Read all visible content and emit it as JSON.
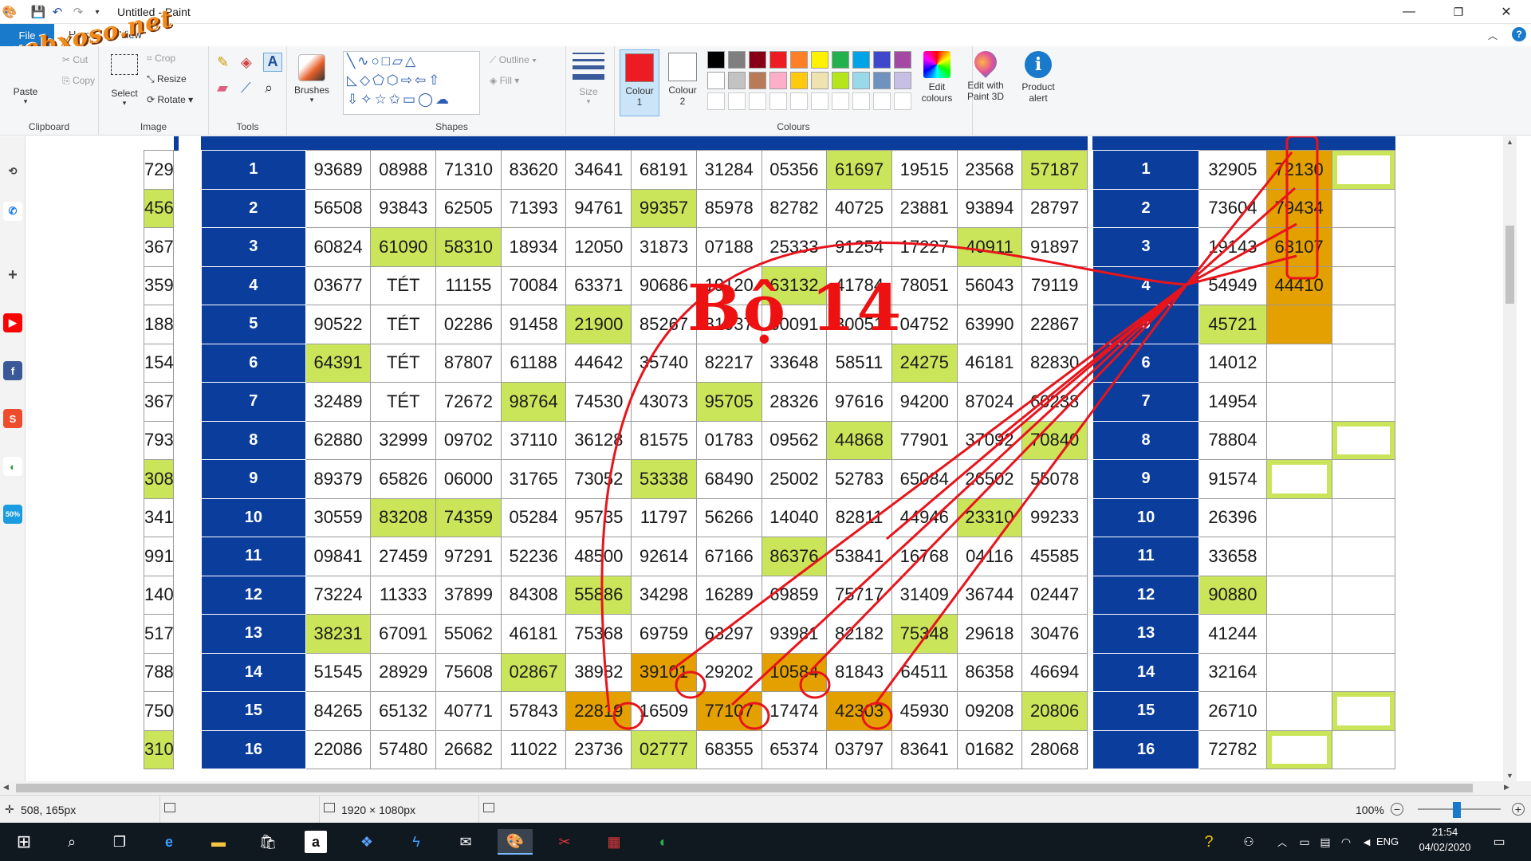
{
  "window": {
    "title": "Untitled - Paint",
    "min": "—",
    "max": "❐",
    "close": "✕"
  },
  "logo_text": "webxoso.net",
  "tabs": {
    "file": "File",
    "home": "Home",
    "view": "View"
  },
  "ribbon": {
    "paste": "Paste",
    "cut": "Cut",
    "copy": "Copy",
    "clipboard": "Clipboard",
    "select": "Select",
    "crop": "Crop",
    "resize": "Resize",
    "rotate": "Rotate",
    "image": "Image",
    "tools": "Tools",
    "brushes": "Brushes",
    "shapes": "Shapes",
    "outline": "Outline",
    "fill": "Fill",
    "size": "Size",
    "colour1": "Colour\n1",
    "colour2": "Colour\n2",
    "colours": "Colours",
    "edit_colours": "Edit\ncolours",
    "edit_paint3d": "Edit with\nPaint 3D",
    "product_alert": "Product\nalert",
    "palette": [
      "#000000",
      "#7f7f7f",
      "#880015",
      "#ed1c24",
      "#ff7f27",
      "#fff200",
      "#22b14c",
      "#00a2e8",
      "#3f48cc",
      "#a349a4",
      "#ffffff",
      "#c3c3c3",
      "#b97a57",
      "#ffaec9",
      "#ffc90e",
      "#efe4b0",
      "#b5e61d",
      "#99d9ea",
      "#7092be",
      "#c8bfe7"
    ],
    "colour1_value": "#ed1c24",
    "colour2_value": "#ffffff"
  },
  "status": {
    "cursor": "508, 165px",
    "dimensions": "1920 × 1080px",
    "zoom": "100%"
  },
  "taskbar": {
    "lang": "ENG",
    "time": "21:54",
    "date": "04/02/2020"
  },
  "annotation": "Bộ 14",
  "left_partial": [
    "729",
    "456",
    "367",
    "359",
    "188",
    "154",
    "367",
    "793",
    "308",
    "341",
    "991",
    "140",
    "517",
    "788",
    "750",
    "310"
  ],
  "left_partial_green": [
    1,
    8,
    15
  ],
  "main_table": {
    "rows": [
      {
        "idx": "1",
        "cells": [
          "93689",
          "08988",
          "71310",
          "83620",
          "34641",
          "68191",
          "31284",
          "05356",
          "61697",
          "19515",
          "23568",
          "57187"
        ],
        "hl": {
          "8": "g",
          "11": "g"
        }
      },
      {
        "idx": "2",
        "cells": [
          "56508",
          "93843",
          "62505",
          "71393",
          "94761",
          "99357",
          "85978",
          "82782",
          "40725",
          "23881",
          "93894",
          "28797"
        ],
        "hl": {
          "5": "g"
        }
      },
      {
        "idx": "3",
        "cells": [
          "60824",
          "61090",
          "58310",
          "18934",
          "12050",
          "31873",
          "07188",
          "25333",
          "91254",
          "17227",
          "40911",
          "91897"
        ],
        "hl": {
          "1": "g",
          "2": "g",
          "10": "g"
        }
      },
      {
        "idx": "4",
        "cells": [
          "03677",
          "TÉT",
          "11155",
          "70084",
          "63371",
          "90686",
          "19120",
          "63132",
          "41784",
          "78051",
          "56043",
          "79119"
        ],
        "hl": {
          "1": "tet",
          "7": "g"
        }
      },
      {
        "idx": "5",
        "cells": [
          "90522",
          "TÉT",
          "02286",
          "91458",
          "21900",
          "85267",
          "81937",
          "60091",
          "30051",
          "04752",
          "63990",
          "22867"
        ],
        "hl": {
          "1": "tet",
          "4": "g"
        }
      },
      {
        "idx": "6",
        "cells": [
          "64391",
          "TÉT",
          "87807",
          "61188",
          "44642",
          "35740",
          "82217",
          "33648",
          "58511",
          "24275",
          "46181",
          "82830"
        ],
        "hl": {
          "0": "g",
          "1": "tet",
          "9": "g"
        }
      },
      {
        "idx": "7",
        "cells": [
          "32489",
          "TÉT",
          "72672",
          "98764",
          "74530",
          "43073",
          "95705",
          "28326",
          "97616",
          "94200",
          "87024",
          "60238"
        ],
        "hl": {
          "1": "tet",
          "3": "g",
          "6": "g"
        }
      },
      {
        "idx": "8",
        "cells": [
          "62880",
          "32999",
          "09702",
          "37110",
          "36128",
          "81575",
          "01783",
          "09562",
          "44868",
          "77901",
          "37092",
          "70840"
        ],
        "hl": {
          "8": "g",
          "11": "g"
        }
      },
      {
        "idx": "9",
        "cells": [
          "89379",
          "65826",
          "06000",
          "31765",
          "73052",
          "53338",
          "68490",
          "25002",
          "52783",
          "65084",
          "26502",
          "55078"
        ],
        "hl": {
          "5": "g"
        }
      },
      {
        "idx": "10",
        "cells": [
          "30559",
          "83208",
          "74359",
          "05284",
          "95735",
          "11797",
          "56266",
          "14040",
          "82811",
          "44946",
          "23310",
          "99233"
        ],
        "hl": {
          "1": "g",
          "2": "g",
          "10": "g"
        }
      },
      {
        "idx": "11",
        "cells": [
          "09841",
          "27459",
          "97291",
          "52236",
          "48500",
          "92614",
          "67166",
          "86376",
          "53841",
          "16768",
          "04116",
          "45585"
        ],
        "hl": {
          "7": "g"
        }
      },
      {
        "idx": "12",
        "cells": [
          "73224",
          "11333",
          "37899",
          "84308",
          "55886",
          "34298",
          "16289",
          "69859",
          "75717",
          "31409",
          "36744",
          "02447"
        ],
        "hl": {
          "4": "g"
        }
      },
      {
        "idx": "13",
        "cells": [
          "38231",
          "67091",
          "55062",
          "46181",
          "75368",
          "69759",
          "63297",
          "93981",
          "82182",
          "75348",
          "29618",
          "30476"
        ],
        "hl": {
          "0": "g",
          "9": "g"
        }
      },
      {
        "idx": "14",
        "cells": [
          "51545",
          "28929",
          "75608",
          "02867",
          "38982",
          "39101",
          "29202",
          "10584",
          "81843",
          "64511",
          "86358",
          "46694"
        ],
        "hl": {
          "3": "g",
          "5": "o",
          "7": "o"
        }
      },
      {
        "idx": "15",
        "cells": [
          "84265",
          "65132",
          "40771",
          "57843",
          "22819",
          "16509",
          "77107",
          "17474",
          "42303",
          "45930",
          "09208",
          "20806"
        ],
        "hl": {
          "4": "o",
          "6": "o",
          "8": "o",
          "11": "g"
        }
      },
      {
        "idx": "16",
        "cells": [
          "22086",
          "57480",
          "26682",
          "11022",
          "23736",
          "02777",
          "68355",
          "65374",
          "03797",
          "83641",
          "01682",
          "28068"
        ],
        "hl": {
          "5": "g"
        }
      }
    ]
  },
  "right_table": {
    "rows": [
      {
        "idx": "1",
        "val": "32905",
        "c2": "72130",
        "c2c": "o",
        "c3": "white"
      },
      {
        "idx": "2",
        "val": "73604",
        "c2": "79434",
        "c2c": "o",
        "c3": ""
      },
      {
        "idx": "3",
        "val": "19143",
        "c2": "63107",
        "c2c": "o",
        "c3": ""
      },
      {
        "idx": "4",
        "val": "54949",
        "c2": "44410",
        "c2c": "o",
        "c3": ""
      },
      {
        "idx": "5",
        "val": "45721",
        "vc": "g",
        "c2": "",
        "c2c": "o",
        "c3": ""
      },
      {
        "idx": "6",
        "val": "14012",
        "c2": "",
        "c2c": "",
        "c3": ""
      },
      {
        "idx": "7",
        "val": "14954",
        "c2": "",
        "c2c": "",
        "c3": ""
      },
      {
        "idx": "8",
        "val": "78804",
        "c2": "",
        "c2c": "",
        "c3": "white"
      },
      {
        "idx": "9",
        "val": "91574",
        "c2": "",
        "c2c": "white",
        "c3": ""
      },
      {
        "idx": "10",
        "val": "26396",
        "c2": "",
        "c2c": "",
        "c3": ""
      },
      {
        "idx": "11",
        "val": "33658",
        "c2": "",
        "c2c": "",
        "c3": ""
      },
      {
        "idx": "12",
        "val": "90880",
        "vc": "g",
        "c2": "",
        "c2c": "",
        "c3": ""
      },
      {
        "idx": "13",
        "val": "41244",
        "c2": "",
        "c2c": "",
        "c3": ""
      },
      {
        "idx": "14",
        "val": "32164",
        "c2": "",
        "c2c": "",
        "c3": ""
      },
      {
        "idx": "15",
        "val": "26710",
        "c2": "",
        "c2c": "",
        "c3": "white"
      },
      {
        "idx": "16",
        "val": "72782",
        "c2": "",
        "c2c": "white",
        "c3": ""
      }
    ]
  }
}
